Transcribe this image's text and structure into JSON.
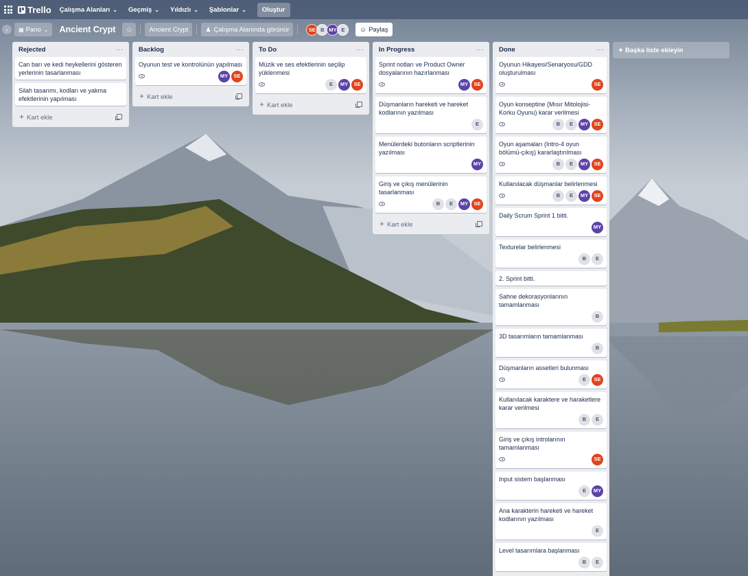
{
  "topnav": {
    "logo": "Trello",
    "items": [
      {
        "label": "Çalışma Alanları"
      },
      {
        "label": "Geçmiş"
      },
      {
        "label": "Yıldızlı"
      },
      {
        "label": "Şablonlar"
      }
    ],
    "create_label": "Oluştur"
  },
  "board_header": {
    "view_label": "Pano",
    "title": "Ancient Crypt",
    "workspace_label": "Ancient Crypt",
    "visibility_label": "Çalışma Alanında görünür",
    "members": [
      "SE",
      "B",
      "MY",
      "E"
    ],
    "share_label": "Paylaş"
  },
  "lists": [
    {
      "title": "Rejected",
      "cards": [
        {
          "title": "Can barı ve kedi heykellerini gösteren yerlerinin tasarlanması",
          "watch": false,
          "members": []
        },
        {
          "title": "Silah tasarımı, kodları ve yakma efektlerinin yapılması",
          "watch": false,
          "members": []
        }
      ]
    },
    {
      "title": "Backlog",
      "cards": [
        {
          "title": "Oyunun test ve kontrolünün yapılması",
          "watch": true,
          "members": [
            "MY",
            "SE"
          ]
        }
      ]
    },
    {
      "title": "To Do",
      "cards": [
        {
          "title": "Müzik ve ses efektlerinin seçilip yüklenmesi",
          "watch": true,
          "members": [
            "E",
            "MY",
            "SE"
          ]
        }
      ]
    },
    {
      "title": "In Progress",
      "cards": [
        {
          "title": "Sprint notları ve Product Owner dosyalarının hazırlanması",
          "watch": true,
          "members": [
            "MY",
            "SE"
          ]
        },
        {
          "title": "Düşmanların hareketi ve hareket kodlarının yazılması",
          "watch": false,
          "members": [
            "E"
          ]
        },
        {
          "title": "Menülerdeki butonların scriptlerinin yazılması",
          "watch": false,
          "members": [
            "MY"
          ]
        },
        {
          "title": "Giriş ve çıkış menülerinin tasarlanması",
          "watch": true,
          "members": [
            "B",
            "E",
            "MY",
            "SE"
          ]
        }
      ]
    },
    {
      "title": "Done",
      "cards": [
        {
          "title": "Oyunun Hikayesi/Senaryosu/GDD oluşturulması",
          "watch": true,
          "members": [
            "SE"
          ]
        },
        {
          "title": "Oyun konseptine (Mısır Mitolojisi-Korku Oyunu) karar verilmesi",
          "watch": true,
          "members": [
            "B",
            "E",
            "MY",
            "SE"
          ]
        },
        {
          "title": "Oyun aşamaları (Intro-4 oyun bölümü-çıkış) kararlaştırılması",
          "watch": true,
          "members": [
            "B",
            "E",
            "MY",
            "SE"
          ]
        },
        {
          "title": "Kullanılacak düşmanlar belirlenmesi",
          "watch": true,
          "members": [
            "B",
            "E",
            "MY",
            "SE"
          ]
        },
        {
          "title": "Daily Scrum Sprint 1 bitti.",
          "watch": false,
          "members": [
            "MY"
          ]
        },
        {
          "title": "Texturelar belirlenmesi",
          "watch": false,
          "members": [
            "B",
            "E"
          ]
        },
        {
          "title": "2. Sprint bitti.",
          "watch": false,
          "members": []
        },
        {
          "title": "Sahne dekorasyonlarının tamamlanması",
          "watch": false,
          "members": [
            "B"
          ]
        },
        {
          "title": "3D tasarımların tamamlanması",
          "watch": false,
          "members": [
            "B"
          ]
        },
        {
          "title": "Düşmanların assetleri bulunması",
          "watch": true,
          "members": [
            "E",
            "SE"
          ]
        },
        {
          "title": "Kullanılacak karaktere ve haraketlere karar verilmesi",
          "watch": false,
          "members": [
            "B",
            "E"
          ]
        },
        {
          "title": "Giriş ve çıkış introlarının tamamlanması",
          "watch": true,
          "members": [
            "SE"
          ]
        },
        {
          "title": "Input sistem başlanması",
          "watch": false,
          "members": [
            "E",
            "MY"
          ]
        },
        {
          "title": "Ana karakterin hareketi ve hareket kodlarının yazılması",
          "watch": false,
          "members": [
            "E"
          ]
        },
        {
          "title": "Level tasarımlara başlanması",
          "watch": false,
          "members": [
            "B",
            "E"
          ]
        }
      ]
    }
  ],
  "add_card_label": "Kart ekle",
  "add_list_label": "Başka liste ekleyin",
  "colors": {
    "SE": "#e0441c",
    "MY": "#5c43a8",
    "B": "#dfe1e6",
    "E": "#dfe1e6"
  }
}
